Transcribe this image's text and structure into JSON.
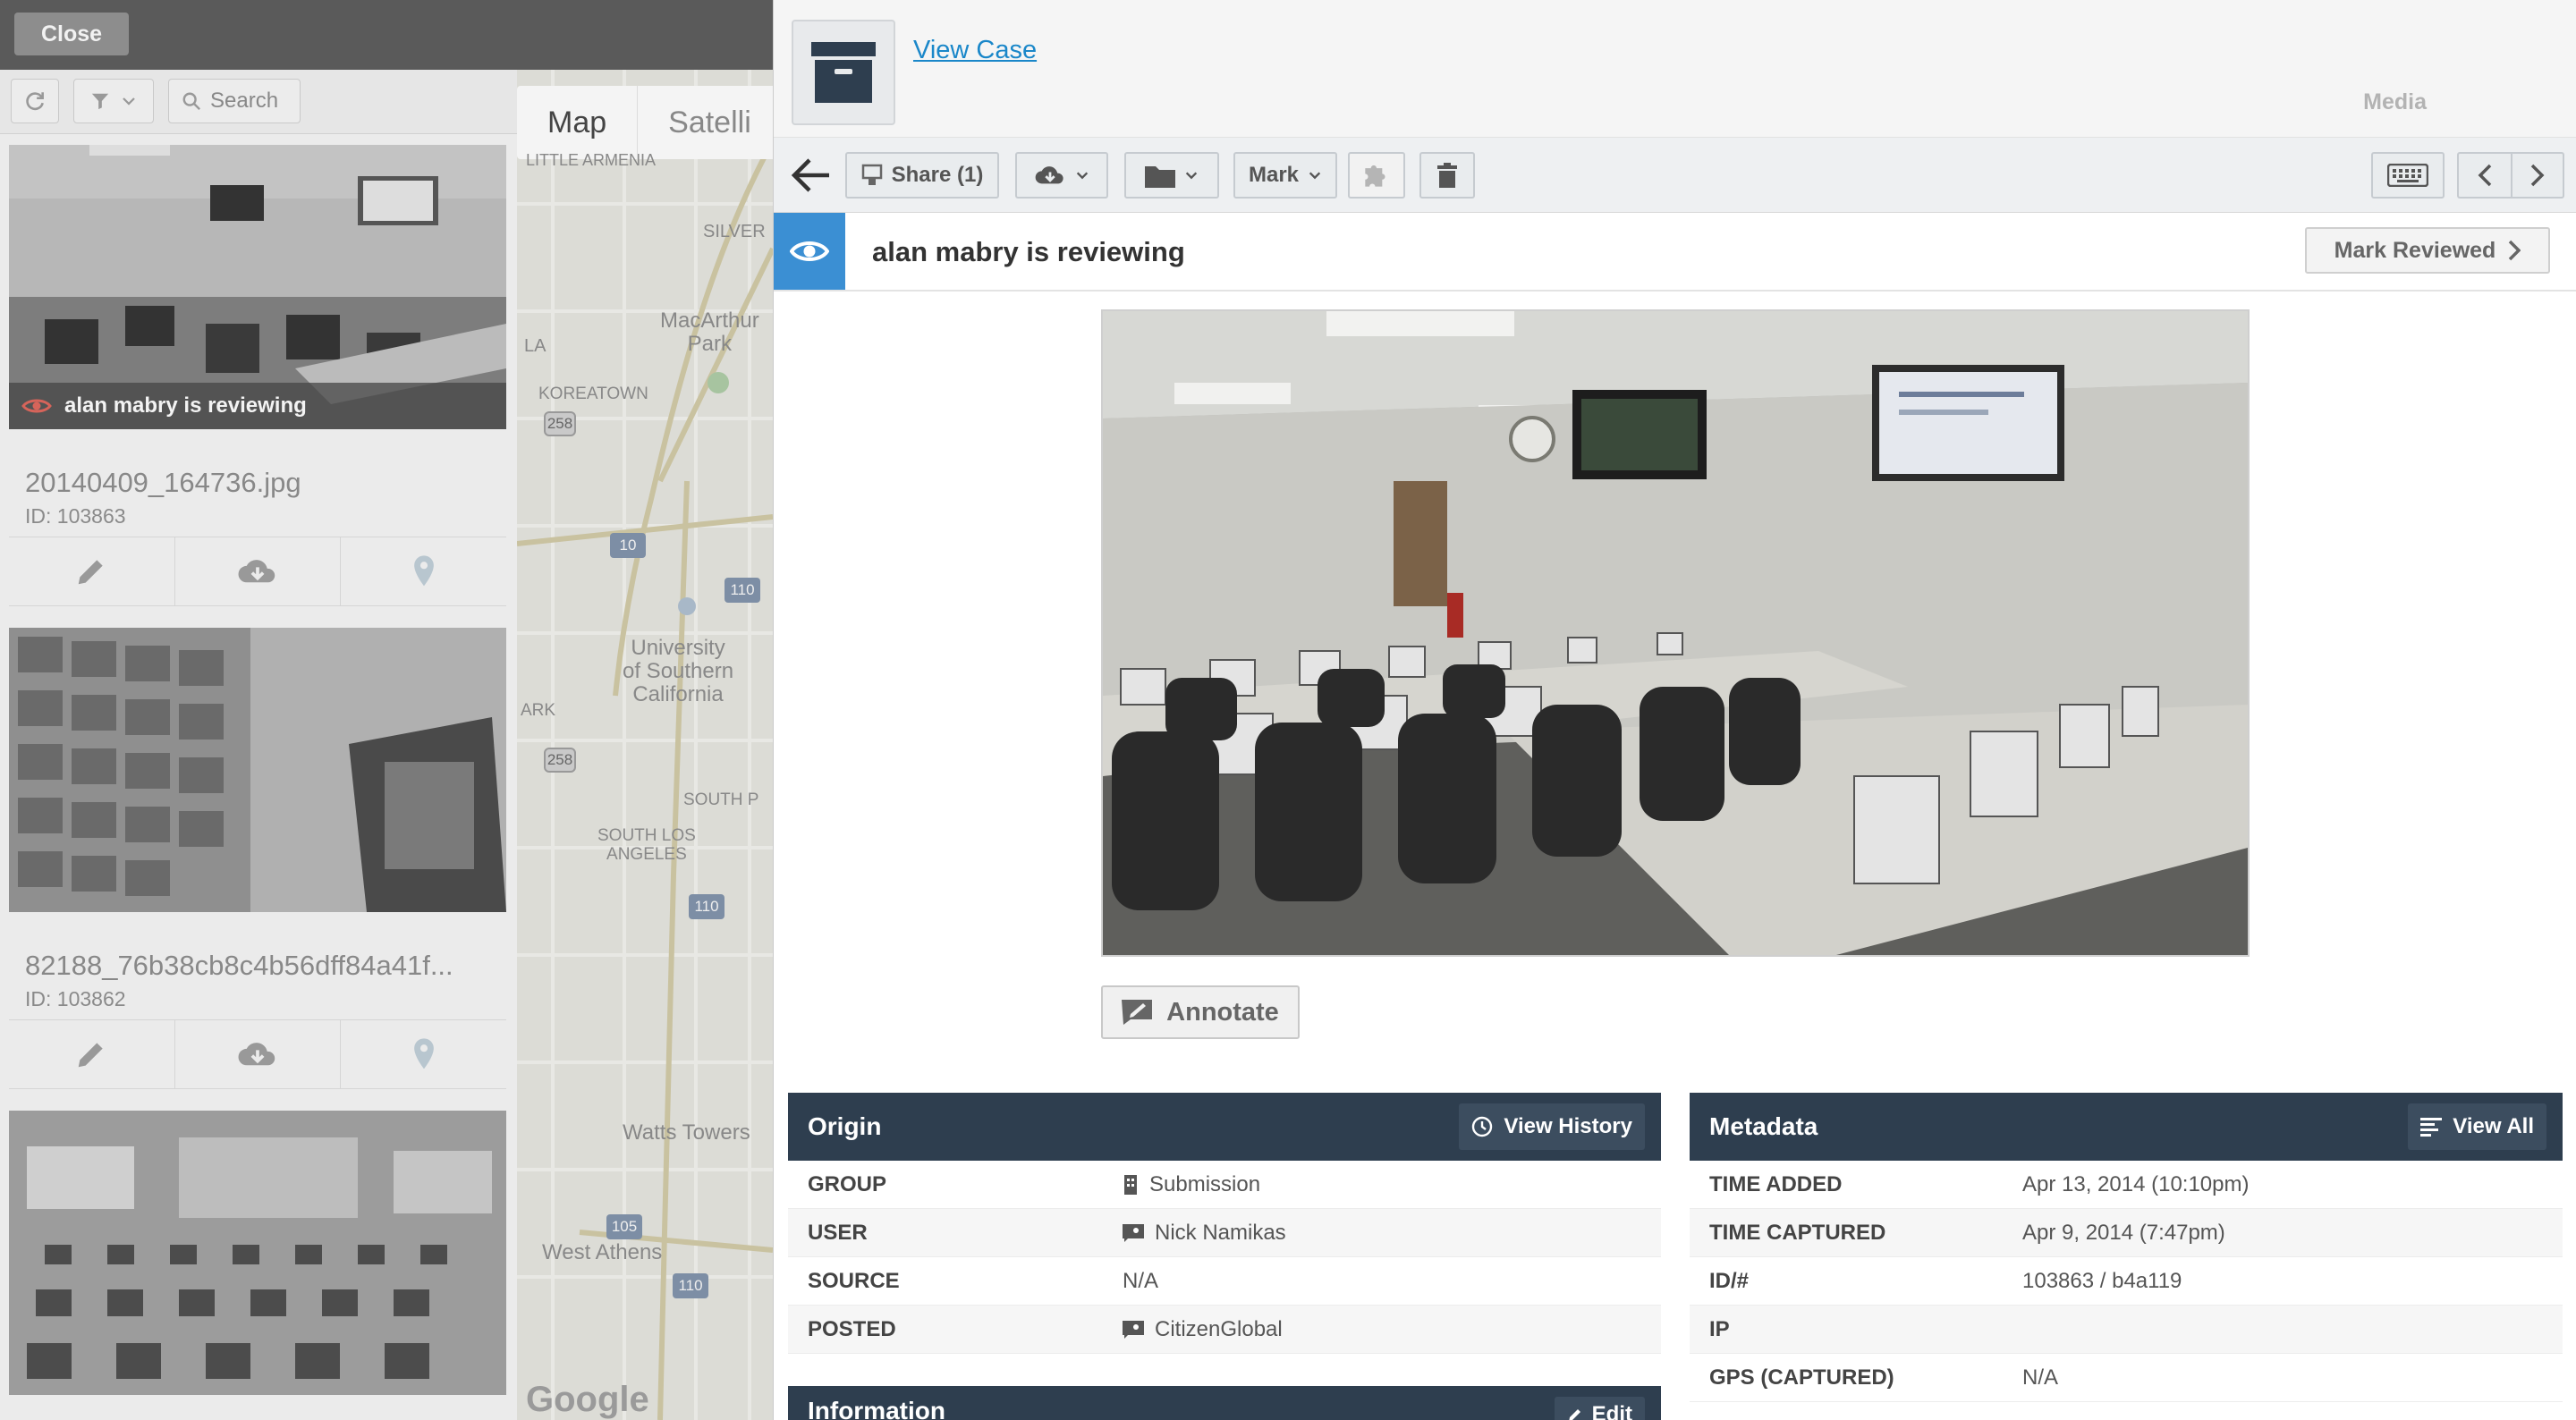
{
  "background_app": {
    "close_label": "Close",
    "search_label": "Search",
    "items": [
      {
        "reviewing_text": "alan mabry  is reviewing",
        "title": "20140409_164736.jpg",
        "id_text": "ID: 103863"
      },
      {
        "reviewing_text": "",
        "title": "82188_76b38cb8c4b56dff84a41f...",
        "id_text": "ID: 103862"
      },
      {
        "reviewing_text": "",
        "title": "",
        "id_text": ""
      }
    ],
    "map": {
      "tab_map": "Map",
      "tab_satellite": "Satelli",
      "labels": {
        "little_armenia": "LITTLE ARMENIA",
        "silver": "SILVER",
        "macarthur_park": "MacArthur\nPark",
        "la": "LA",
        "koreatown": "KOREATOWN",
        "usc": "University\nof Southern\nCalifornia",
        "ark": "ARK",
        "south_p": "SOUTH P",
        "south_los_angeles": "SOUTH LOS\nANGELES",
        "watts_towers": "Watts Towers",
        "west_athens": "West Athens",
        "google": "Google"
      },
      "shields": [
        "258",
        "258"
      ],
      "interstates": [
        "10",
        "110",
        "110",
        "105",
        "110"
      ]
    }
  },
  "panel": {
    "view_case_label": "View Case",
    "media_label": "Media",
    "toolbar": {
      "share_label": "Share (1)",
      "mark_label": "Mark"
    },
    "review_text": "alan mabry is reviewing",
    "mark_reviewed_label": "Mark Reviewed",
    "annotate_label": "Annotate",
    "origin": {
      "title": "Origin",
      "action_label": "View History",
      "rows": [
        {
          "key": "GROUP",
          "value": "Submission"
        },
        {
          "key": "USER",
          "value": "Nick Namikas"
        },
        {
          "key": "SOURCE",
          "value": "N/A"
        },
        {
          "key": "POSTED",
          "value": "CitizenGlobal"
        }
      ]
    },
    "metadata": {
      "title": "Metadata",
      "action_label": "View All",
      "rows": [
        {
          "key": "TIME ADDED",
          "value": "Apr 13, 2014 (10:10pm)"
        },
        {
          "key": "TIME CAPTURED",
          "value": "Apr 9, 2014 (7:47pm)"
        },
        {
          "key": "ID/#",
          "value": "103863 / b4a119"
        },
        {
          "key": "IP",
          "value": ""
        },
        {
          "key": "GPS (CAPTURED)",
          "value": "N/A"
        }
      ]
    },
    "information": {
      "title": "Information",
      "action_label": "Edit"
    }
  },
  "colors": {
    "accent_blue": "#3b8fd3",
    "link_blue": "#1a87c9",
    "card_header": "#2e3e4f"
  }
}
